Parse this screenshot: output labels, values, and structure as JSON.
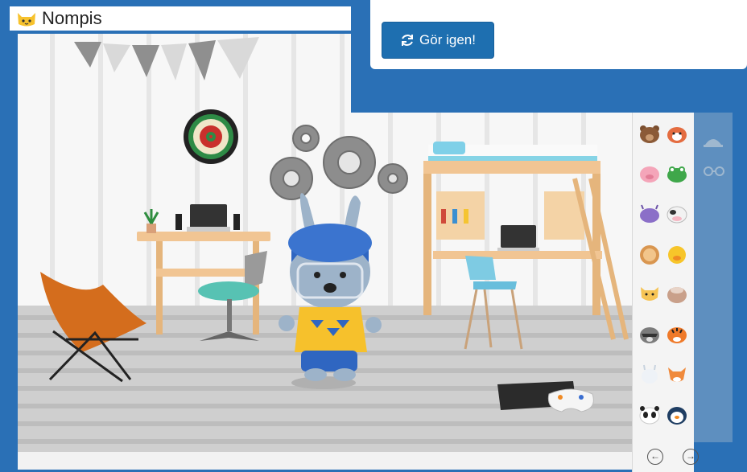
{
  "app": {
    "title": "Nompis"
  },
  "dialog": {
    "again_button_label": "Gör igen!"
  },
  "colors": {
    "brand_blue": "#2a70b6",
    "button_blue": "#1e6fb0",
    "scene_bg": "#f3f3f3"
  },
  "palette": {
    "animals": [
      "bear",
      "red-panda",
      "pig",
      "frog",
      "purple-monster",
      "cow",
      "lion",
      "duck",
      "tiger-cat",
      "sheep",
      "raccoon",
      "tiger",
      "llama",
      "fox",
      "panda",
      "penguin"
    ],
    "nav": {
      "prev_icon": "arrow-left-icon",
      "next_icon": "arrow-right-icon"
    }
  },
  "accessories": [
    "hat",
    "glasses"
  ]
}
